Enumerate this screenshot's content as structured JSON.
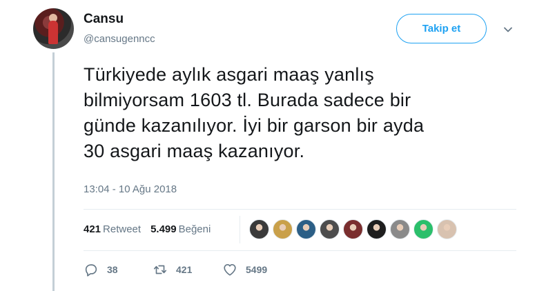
{
  "user": {
    "name": "Cansu",
    "handle": "@cansugenncc"
  },
  "follow_button": "Takip et",
  "tweet": {
    "lines": [
      "Türkiyede aylık asgari maaş yanlış",
      "bilmiyorsam 1603 tl. Burada sadece bir",
      "günde kazanılıyor. İyi bir garson bir ayda",
      "30 asgari maaş kazanıyor."
    ],
    "timestamp": "13:04 - 10 Ağu 2018"
  },
  "stats": {
    "retweets_count": "421",
    "retweets_label": "Retweet",
    "likes_count": "5.499",
    "likes_label": "Beğeni"
  },
  "likers": [
    {
      "icon": "liker-avatar",
      "color": "#3a3a3a"
    },
    {
      "icon": "liker-avatar",
      "color": "#c9a04a"
    },
    {
      "icon": "liker-avatar",
      "color": "#2c5f86"
    },
    {
      "icon": "liker-avatar",
      "color": "#4d4d4d"
    },
    {
      "icon": "liker-avatar",
      "color": "#7a2e2e"
    },
    {
      "icon": "liker-avatar",
      "color": "#1e1e1e"
    },
    {
      "icon": "liker-avatar",
      "color": "#8a8a8a"
    },
    {
      "icon": "liker-avatar",
      "color": "#2bbf6b"
    },
    {
      "icon": "liker-avatar",
      "color": "#d8c2b0"
    }
  ],
  "actions": {
    "reply_count": "38",
    "retweet_count": "421",
    "like_count": "5499"
  },
  "colors": {
    "accent": "#1da1f2",
    "muted": "#657786",
    "text": "#14171a"
  }
}
